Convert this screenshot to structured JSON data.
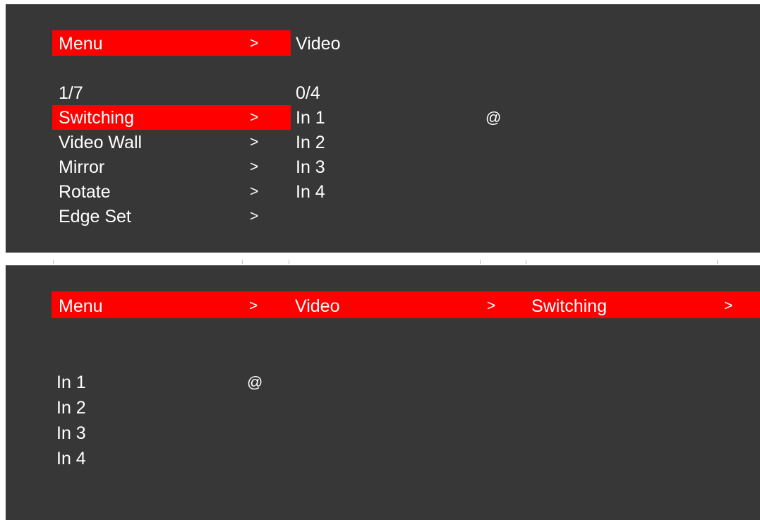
{
  "top_screen": {
    "header": {
      "menu_label": "Menu",
      "arrow": ">",
      "submenu_label": "Video"
    },
    "left_column": {
      "page_indicator": "1/7",
      "items": [
        {
          "label": "Switching",
          "arrow": ">",
          "selected": true
        },
        {
          "label": "Video Wall",
          "arrow": ">"
        },
        {
          "label": "Mirror",
          "arrow": ">"
        },
        {
          "label": "Rotate",
          "arrow": ">"
        },
        {
          "label": "Edge Set",
          "arrow": ">"
        }
      ]
    },
    "right_column": {
      "page_indicator": "0/4",
      "items": [
        {
          "label": "In 1",
          "marker": "@"
        },
        {
          "label": "In 2"
        },
        {
          "label": "In 3"
        },
        {
          "label": "In 4"
        }
      ]
    }
  },
  "bottom_screen": {
    "breadcrumb": {
      "items": [
        {
          "label": "Menu",
          "arrow": ">"
        },
        {
          "label": "Video",
          "arrow": ">"
        },
        {
          "label": "Switching",
          "arrow": ">"
        }
      ]
    },
    "inputs": [
      {
        "label": "In 1",
        "marker": "@"
      },
      {
        "label": "In 2"
      },
      {
        "label": "In 3"
      },
      {
        "label": "In 4"
      }
    ]
  },
  "colors": {
    "background": "#373737",
    "highlight": "#ff0000",
    "text": "#ffffff"
  }
}
